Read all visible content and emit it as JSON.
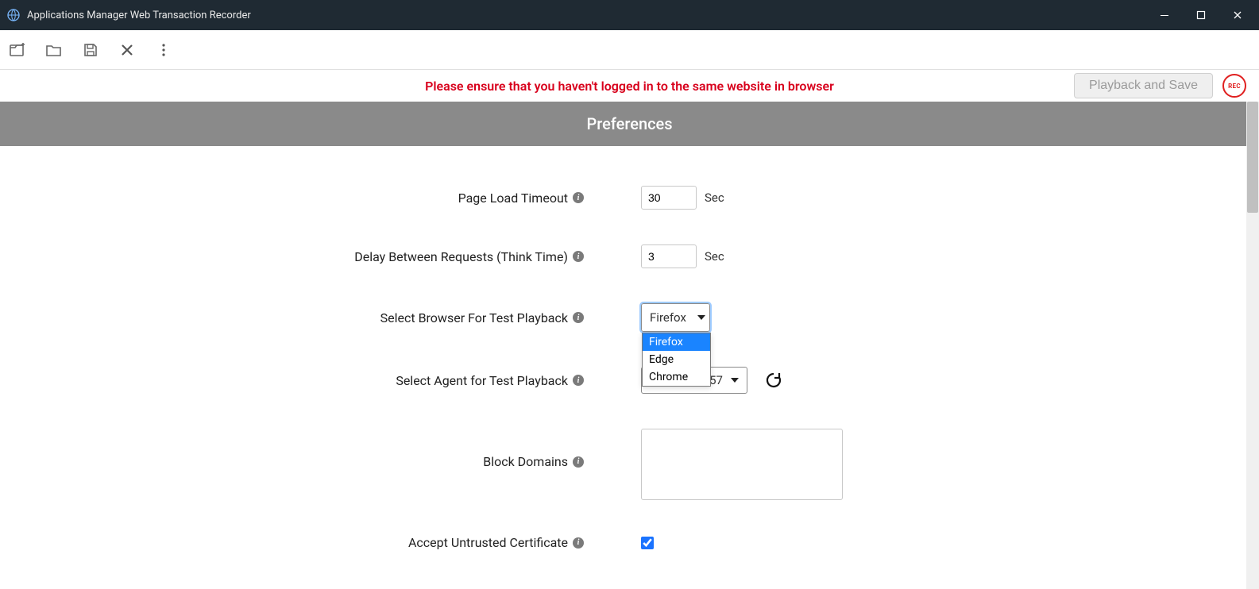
{
  "window": {
    "title": "Applications Manager Web Transaction Recorder"
  },
  "toolbar": {
    "icons": {
      "new": "new-file-icon",
      "open": "open-folder-icon",
      "save": "save-icon",
      "close": "close-icon",
      "more": "more-vertical-icon"
    }
  },
  "actionbar": {
    "warning": "Please ensure that you haven't logged in to the same website in browser",
    "playback_label": "Playback and Save",
    "rec_label": "REC"
  },
  "preferences": {
    "title": "Preferences",
    "fields": {
      "page_load_timeout": {
        "label": "Page Load Timeout",
        "value": "30",
        "unit": "Sec"
      },
      "think_time": {
        "label": "Delay Between Requests (Think Time)",
        "value": "3",
        "unit": "Sec"
      },
      "browser": {
        "label": "Select Browser For Test Playback",
        "selected": "Firefox",
        "options": [
          "Firefox",
          "Edge",
          "Chrome"
        ]
      },
      "agent": {
        "label": "Select Agent for Test Playback",
        "visible_value": "57"
      },
      "block_domains": {
        "label": "Block Domains",
        "value": ""
      },
      "accept_untrusted": {
        "label": "Accept Untrusted Certificate",
        "checked": true
      }
    }
  }
}
